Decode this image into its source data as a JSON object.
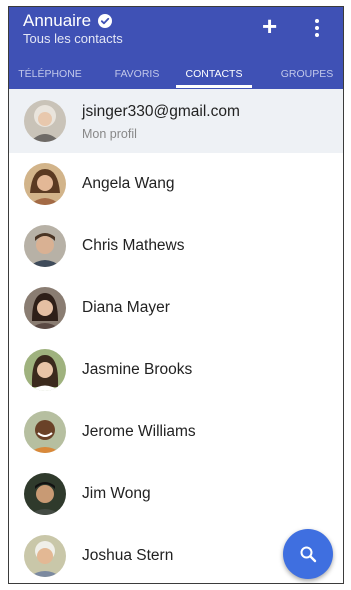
{
  "header": {
    "title": "Annuaire",
    "subtitle": "Tous les contacts",
    "add_icon": "plus-icon",
    "menu_icon": "more-vertical-icon",
    "verified_icon": "check-circle-icon"
  },
  "tabs": [
    {
      "label": "TÉLÉPHONE"
    },
    {
      "label": "FAVORIS"
    },
    {
      "label": "CONTACTS"
    },
    {
      "label": "GROUPES"
    }
  ],
  "active_tab": "CONTACTS",
  "profile": {
    "name": "jsinger330@gmail.com",
    "sub": "Mon profil"
  },
  "contacts": [
    {
      "name": "Angela Wang"
    },
    {
      "name": "Chris Mathews"
    },
    {
      "name": "Diana Mayer"
    },
    {
      "name": "Jasmine Brooks"
    },
    {
      "name": "Jerome Williams"
    },
    {
      "name": "Jim Wong"
    },
    {
      "name": "Joshua Stern"
    }
  ],
  "fab": {
    "icon": "search-icon"
  },
  "colors": {
    "primary": "#3f51b5",
    "fab": "#3f6fe0",
    "profile_bg": "#eef1f5"
  }
}
